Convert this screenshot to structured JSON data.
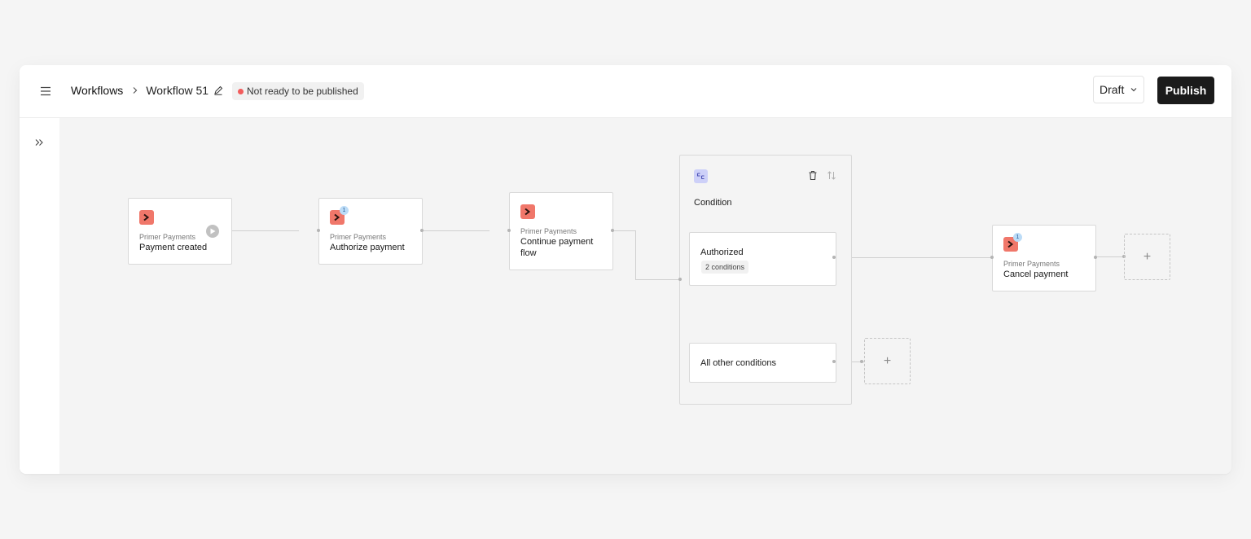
{
  "header": {
    "breadcrumb_root": "Workflows",
    "workflow_name": "Workflow 51",
    "status_text": "Not ready to be published",
    "status_color": "#f25c5c",
    "draft_label": "Draft",
    "publish_label": "Publish"
  },
  "icons": {
    "menu": "hamburger-menu-icon",
    "separator": "chevron-right-icon",
    "edit": "pencil-icon",
    "sidebar_toggle": "double-chevron-right-icon",
    "node": "primer-logo-icon",
    "condition": "branch-icon",
    "delete": "trash-icon",
    "reorder": "sort-arrows-icon",
    "add": "plus-icon"
  },
  "nodes": {
    "trigger": {
      "provider": "Primer Payments",
      "title": "Payment created"
    },
    "authorize": {
      "provider": "Primer Payments",
      "title": "Authorize payment",
      "badge": "1"
    },
    "continue": {
      "provider": "Primer Payments",
      "title_line1": "Continue payment",
      "title_line2": "flow"
    },
    "cancel": {
      "provider": "Primer Payments",
      "title": "Cancel payment",
      "badge": "1"
    }
  },
  "condition": {
    "title": "Condition",
    "branches": [
      {
        "title": "Authorized",
        "tag": "2 conditions"
      },
      {
        "title": "All other conditions"
      }
    ]
  },
  "add_step_symbol": "+",
  "colors": {
    "node_icon": "#f0776a",
    "condition_icon": "#cdd0f8",
    "badge": "#bcdcf7",
    "publish_button": "#1b1b1b"
  }
}
